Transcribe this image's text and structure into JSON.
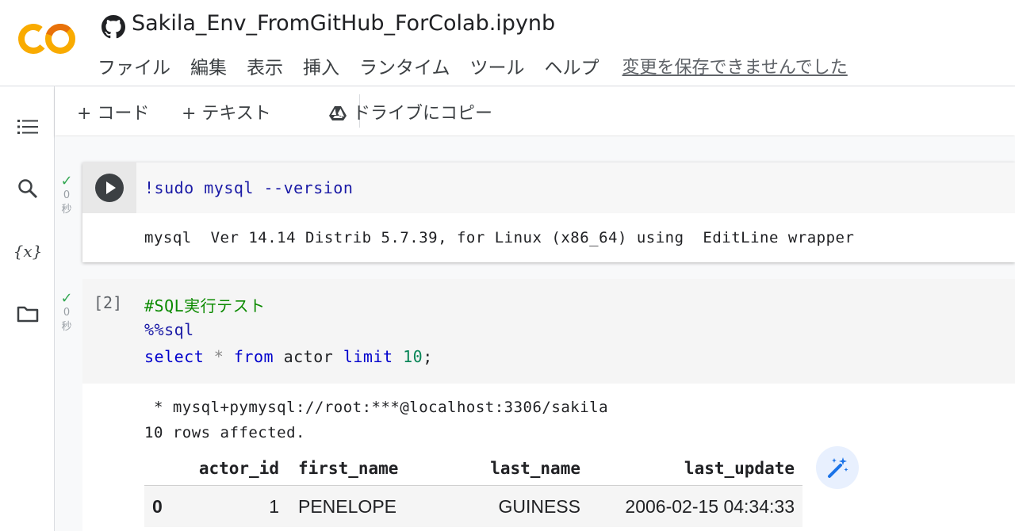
{
  "header": {
    "notebook_title": "Sakila_Env_FromGitHub_ForColab.ipynb",
    "menu": [
      "ファイル",
      "編集",
      "表示",
      "挿入",
      "ランタイム",
      "ツール",
      "ヘルプ"
    ],
    "save_status": "変更を保存できませんでした"
  },
  "sidebar": {
    "items": [
      {
        "icon": "table-of-contents-icon"
      },
      {
        "icon": "search-icon"
      },
      {
        "icon": "variables-icon",
        "label": "{x}"
      },
      {
        "icon": "folder-icon"
      }
    ]
  },
  "toolbar": {
    "add_code": "+ コード",
    "add_text": "+ テキスト",
    "copy_to_drive": "ドライブにコピー"
  },
  "cells": [
    {
      "exec_time": "0",
      "exec_unit": "秒",
      "code": "!sudo mysql --version",
      "output": "mysql  Ver 14.14 Distrib 5.7.39, for Linux (x86_64) using  EditLine wrapper"
    },
    {
      "exec_count": "[2]",
      "exec_time": "0",
      "exec_unit": "秒",
      "code_lines": {
        "comment": "#SQL実行テスト",
        "magic": "%%sql",
        "kw_select": "select",
        "star": " * ",
        "kw_from": "from",
        "table": " actor ",
        "kw_limit": "limit",
        "space": " ",
        "num": "10",
        "semi": ";"
      },
      "output_lines": [
        " * mysql+pymysql://root:***@localhost:3306/sakila",
        "10 rows affected."
      ],
      "table": {
        "columns": [
          "",
          "actor_id",
          "first_name",
          "last_name",
          "last_update"
        ],
        "rows": [
          {
            "index": "0",
            "actor_id": "1",
            "first_name": "PENELOPE",
            "last_name": "GUINESS",
            "last_update": "2006-02-15 04:34:33"
          }
        ]
      }
    }
  ],
  "colors": {
    "accent_orange": "#f9ab00",
    "run_button": "#3c4043",
    "success_check": "#34a853",
    "keyword": "#0000cc",
    "comment": "#0b8a00"
  }
}
